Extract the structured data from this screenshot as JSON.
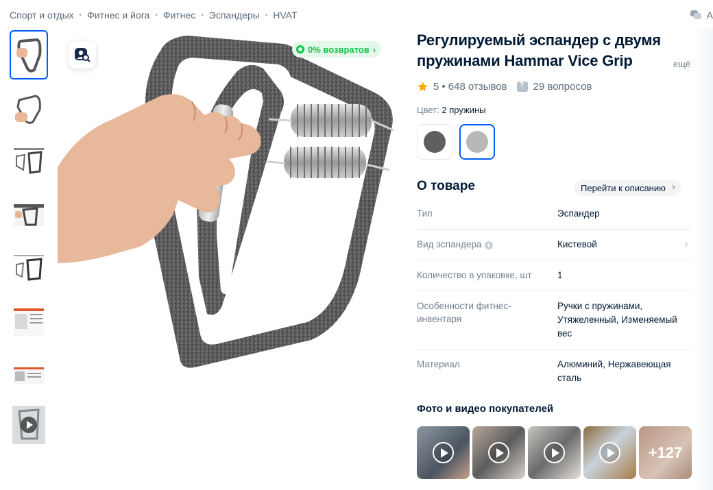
{
  "breadcrumb": {
    "items": [
      "Спорт и отдых",
      "Фитнес и йога",
      "Фитнес",
      "Эспандеры",
      "HVAT"
    ],
    "separator": "•"
  },
  "top_right": {
    "label": "А"
  },
  "gallery": {
    "thumbnails": [
      "photo-1",
      "photo-2",
      "photo-3",
      "photo-4",
      "photo-5",
      "photo-6",
      "photo-7",
      "video-8"
    ],
    "active_index": 0,
    "returns_badge": "0% возвратов"
  },
  "product": {
    "title": "Регулируемый эспандер с двумя пружинами Hammar Vice Grip",
    "title_more": "ещё",
    "rating": "5",
    "reviews": "• 648 отзывов",
    "questions": "29 вопросов",
    "star_color": "#ffa800"
  },
  "color": {
    "label": "Цвет:",
    "value": "2 пружины",
    "options": [
      {
        "color": "#5f5f5f"
      },
      {
        "color": "#b8b8b8"
      }
    ],
    "selected_index": 1
  },
  "about": {
    "title": "О товаре",
    "goto_label": "Перейти к описанию",
    "specs": [
      {
        "key": "Тип",
        "value": "Эспандер"
      },
      {
        "key": "Вид эспандера",
        "value": "Кистевой",
        "info": true,
        "chevron": true
      },
      {
        "key": "Количество в упаковке, шт",
        "value": "1"
      },
      {
        "key": "Особенности фитнес-инвентаря",
        "value": "Ручки с пружинами, Утяжеленный, Изменяемый вес"
      },
      {
        "key": "Материал",
        "value": "Алюминий, Нержавеющая сталь"
      }
    ]
  },
  "customer_media": {
    "title": "Фото и видео покупателей",
    "items": [
      "video",
      "video",
      "video",
      "video",
      "photo"
    ],
    "more_count": "+127"
  },
  "colors": {
    "accent": "#005bff",
    "green": "#10c44c",
    "text": "#001a34",
    "muted": "#707f8d"
  }
}
